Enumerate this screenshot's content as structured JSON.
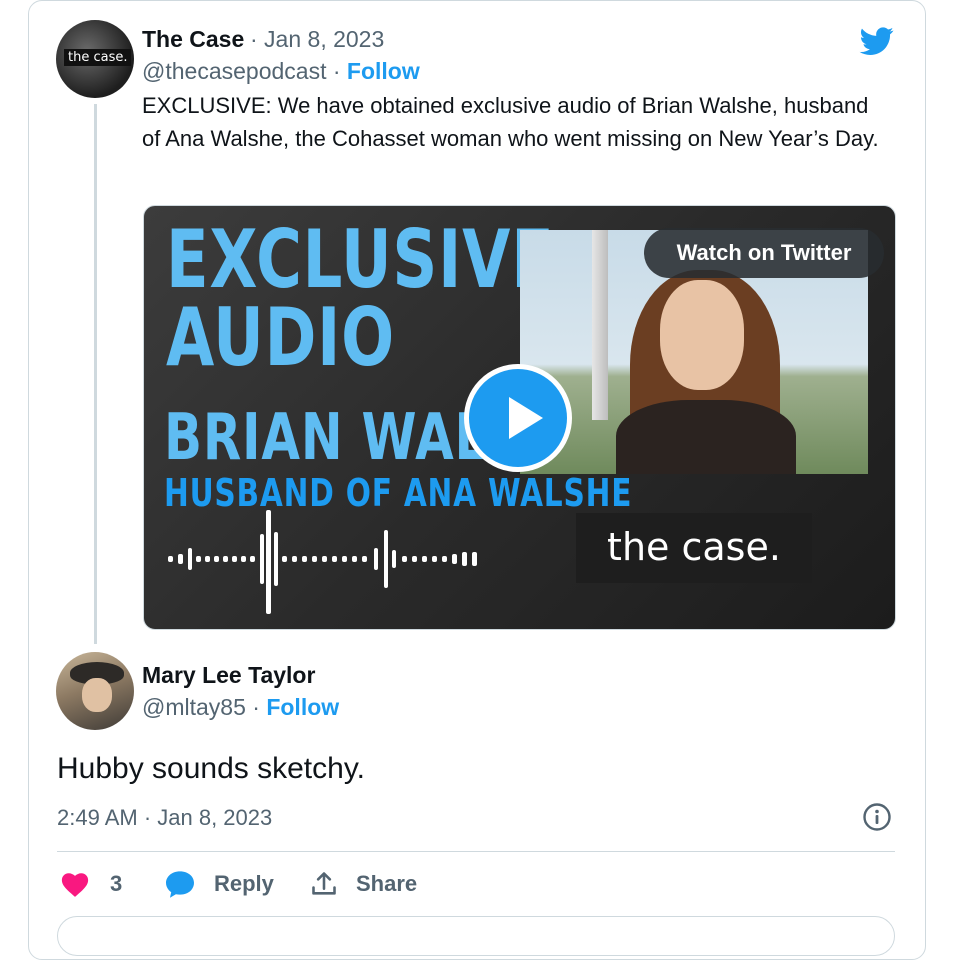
{
  "tweet1": {
    "avatar_text": "the case.",
    "name": "The Case",
    "date": "· Jan 8, 2023",
    "handle": "@thecasepodcast ·",
    "follow_label": "Follow",
    "text": "EXCLUSIVE: We have obtained exclusive audio of Brian Walshe, husband of Ana Walshe, the Cohasset woman who went missing on New Year’s Day."
  },
  "media": {
    "line1": "EXCLUSIVE",
    "line2": "AUDIO",
    "line3": "BRIAN WALSHE",
    "line4": "HUSBAND OF ANA WALSHE",
    "watch_label": "Watch on Twitter",
    "logo_text": "the case."
  },
  "tweet2": {
    "name": "Mary Lee Taylor",
    "handle": "@mltay85 ·",
    "follow_label": "Follow",
    "text": "Hubby sounds sketchy.",
    "timestamp": "2:49 AM · Jan 8, 2023"
  },
  "actions": {
    "like_count": "3",
    "reply_label": "Reply",
    "share_label": "Share"
  },
  "colors": {
    "accent": "#1d9bf0",
    "like": "#f91880",
    "muted": "#536471",
    "text": "#0f1419",
    "media_title": "#5fbcf2"
  },
  "icons": [
    "twitter-bird-icon",
    "play-icon",
    "info-icon",
    "heart-icon",
    "reply-bubble-icon",
    "share-icon"
  ]
}
